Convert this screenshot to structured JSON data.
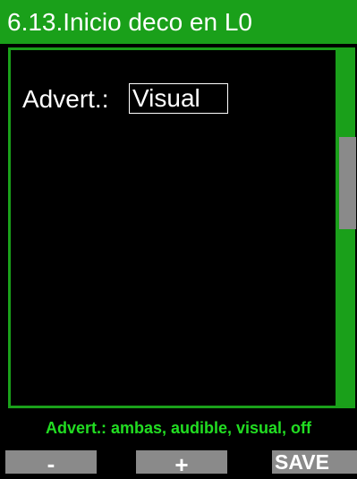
{
  "header": {
    "title": "6.13.Inicio deco en L0"
  },
  "setting": {
    "label": "Advert.:",
    "value": "Visual"
  },
  "hint": {
    "text": "Advert.: ambas, audible, visual, off"
  },
  "softkeys": {
    "minus": "-",
    "plus": "+",
    "save": "SAVE"
  },
  "colors": {
    "accent": "#1aa01a",
    "hint_text": "#22dd22",
    "softkey_bg": "#8a8a8a",
    "background": "#000000",
    "text": "#ffffff"
  }
}
